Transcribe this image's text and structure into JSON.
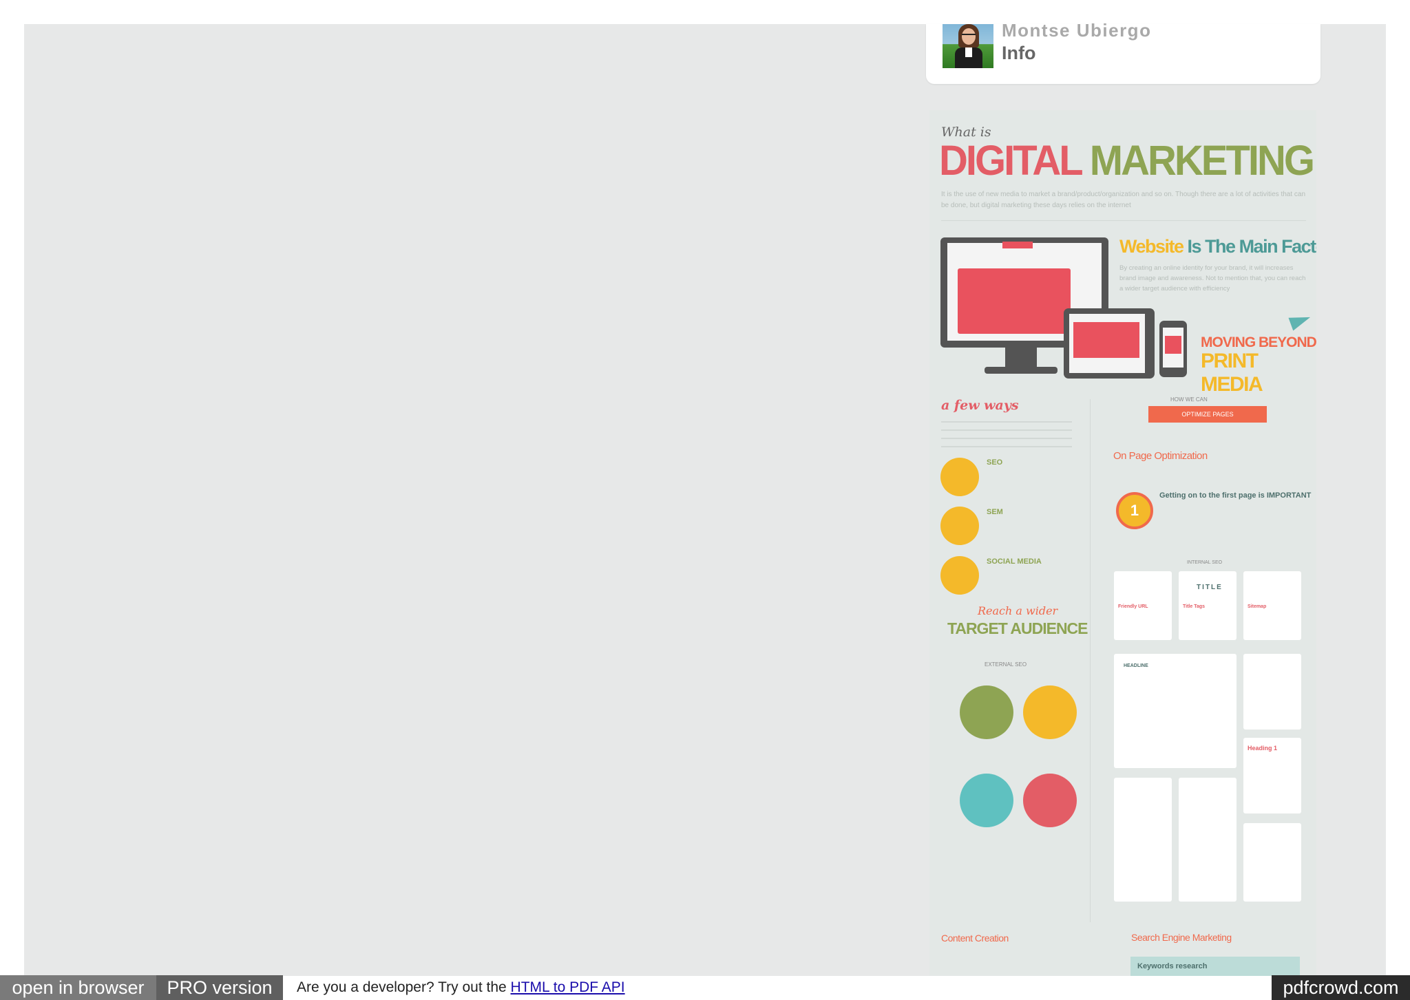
{
  "author": {
    "name": "Montse Ubiergo",
    "info_link": "Info"
  },
  "infographic": {
    "what_is": "What is",
    "title_part1": "DIGITAL",
    "title_part2": "MARKETING",
    "intro": "It is the use of new media to market a brand/product/organization and so on. Though there are a lot of activities that can be done, but digital marketing these days relies on the internet",
    "website_head_word1": "Website",
    "website_head_rest": "Is The Main Factor",
    "website_body": "By creating an online identity for your brand, it will increases brand image and awareness. Not to mention that, you can reach a wider target audience with efficiency",
    "moving_beyond": "MOVING BEYOND",
    "print_media": "PRINT MEDIA",
    "few_ways": "a few ways",
    "ways": [
      {
        "label": "SEO",
        "icon": "search-icon",
        "color": "#f4b92a"
      },
      {
        "label": "SEM",
        "icon": "ad-icon",
        "color": "#f4b92a"
      },
      {
        "label": "SOCIAL MEDIA",
        "icon": "chat-icon",
        "color": "#f4b92a"
      }
    ],
    "reach_a_wider": "Reach a wider",
    "target_audience": "TARGET AUDIENCE",
    "external_seo": "EXTERNAL SEO",
    "how_we_can": "HOW WE CAN",
    "optimize_pages": "OPTIMIZE PAGES",
    "on_page_optimization": "On Page Optimization",
    "medal_number": "1",
    "getting_first_page": "Getting on to the first page is IMPORTANT",
    "internal_seo": "INTERNAL SEO",
    "cards": [
      "Friendly URL",
      "Title Tags",
      "Sitemap"
    ],
    "title_card_word": "TITLE",
    "headline": "HEADLINE",
    "heading_1": "Heading 1",
    "content_creation": "Content Creation",
    "search_engine_marketing": "Search Engine Marketing",
    "keywords_research": "Keywords research",
    "colors": {
      "red": "#e35d66",
      "green": "#8ea453",
      "yellow": "#f4b92a",
      "teal": "#4d9a96",
      "orange": "#f0694c"
    }
  },
  "footer": {
    "open_in_browser": "open in browser",
    "pro_version": "PRO version",
    "developer_text": "Are you a developer? Try out the",
    "api_link": "HTML to PDF API",
    "brand": "pdfcrowd.com"
  }
}
